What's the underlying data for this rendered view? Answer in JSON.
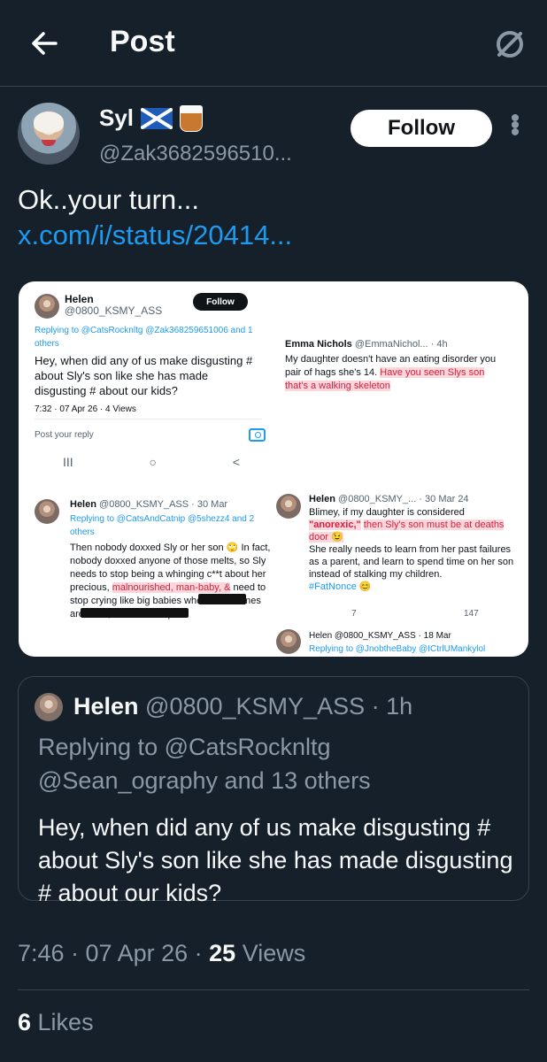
{
  "header": {
    "title": "Post"
  },
  "author": {
    "name": "Syl",
    "handle": "@Zak3682596510...",
    "follow_label": "Follow"
  },
  "post": {
    "text": "Ok..your turn...",
    "link": "x.com/i/status/20414..."
  },
  "image": {
    "left": {
      "name": "Helen",
      "handle": "@0800_KSMY_ASS",
      "follow": "Follow",
      "replying": "Replying to @CatsRocknltg @Zak368259651006 and 1 others",
      "text": "Hey, when did any of us make disgusting # about Sly's son like she has made disgusting # about our kids?",
      "time": "7:32 · 07 Apr 26 · 4 Views",
      "reply_placeholder": "Post your reply",
      "nav": [
        "III",
        "○",
        "<"
      ]
    },
    "right_top": {
      "name": "Emma Nichols",
      "handle": "@EmmaNichol... · 4h",
      "text_plain": "My daughter doesn't have an eating disorder you pair of hags she's 14.",
      "text_highlight": "Have you seen Slys son that's a walking skeleton"
    },
    "bottom_left": {
      "name": "Helen",
      "handle": "@0800_KSMY_ASS · 30 Mar",
      "replying": "Replying to @CatsAndCatnip @5shezz4 and 2 others",
      "text": "Then nobody doxxed Sly or her son 🙄 In fact, nobody doxxed anyone of those melts, so Sly needs to stop being a whinging c**t about her precious,",
      "highlight": "malnourished, man-baby, &",
      "text_tail": "need to stop crying like big babies when their names are used, and suck it up."
    },
    "bottom_right": {
      "name": "Helen",
      "handle": "@0800_KSMY_... · 30 Mar 24",
      "text_1": "Blimey, if my daughter is considered",
      "anorexic": "\"anorexic,\"",
      "text_2": "then Sly's son must be at deaths door 😉",
      "text_3": "She really needs to learn from her past failures as a parent, and learn to spend time on her son instead of stalking my children.",
      "hashtag": "#FatNonce 😊",
      "stats": [
        "7",
        "147"
      ],
      "footer_name": "Helen @0800_KSMY_ASS · 18 Mar",
      "footer_reply": "Replying to @JnobtheBaby @ICtrlUMankylol"
    }
  },
  "quote": {
    "name": "Helen",
    "handle_time": "@0800_KSMY_ASS · 1h",
    "replying_line1": "Replying to @CatsRocknltg",
    "replying_line2": "@Sean_ography and 13 others",
    "text": "Hey, when did any of us make disgusting # about Sly's son like she has made disgusting # about our kids?"
  },
  "meta": {
    "time": "7:46 · 07 Apr 26 · ",
    "views_count": "25",
    "views_label": " Views"
  },
  "likes": {
    "count": "6",
    "label": " Likes"
  }
}
